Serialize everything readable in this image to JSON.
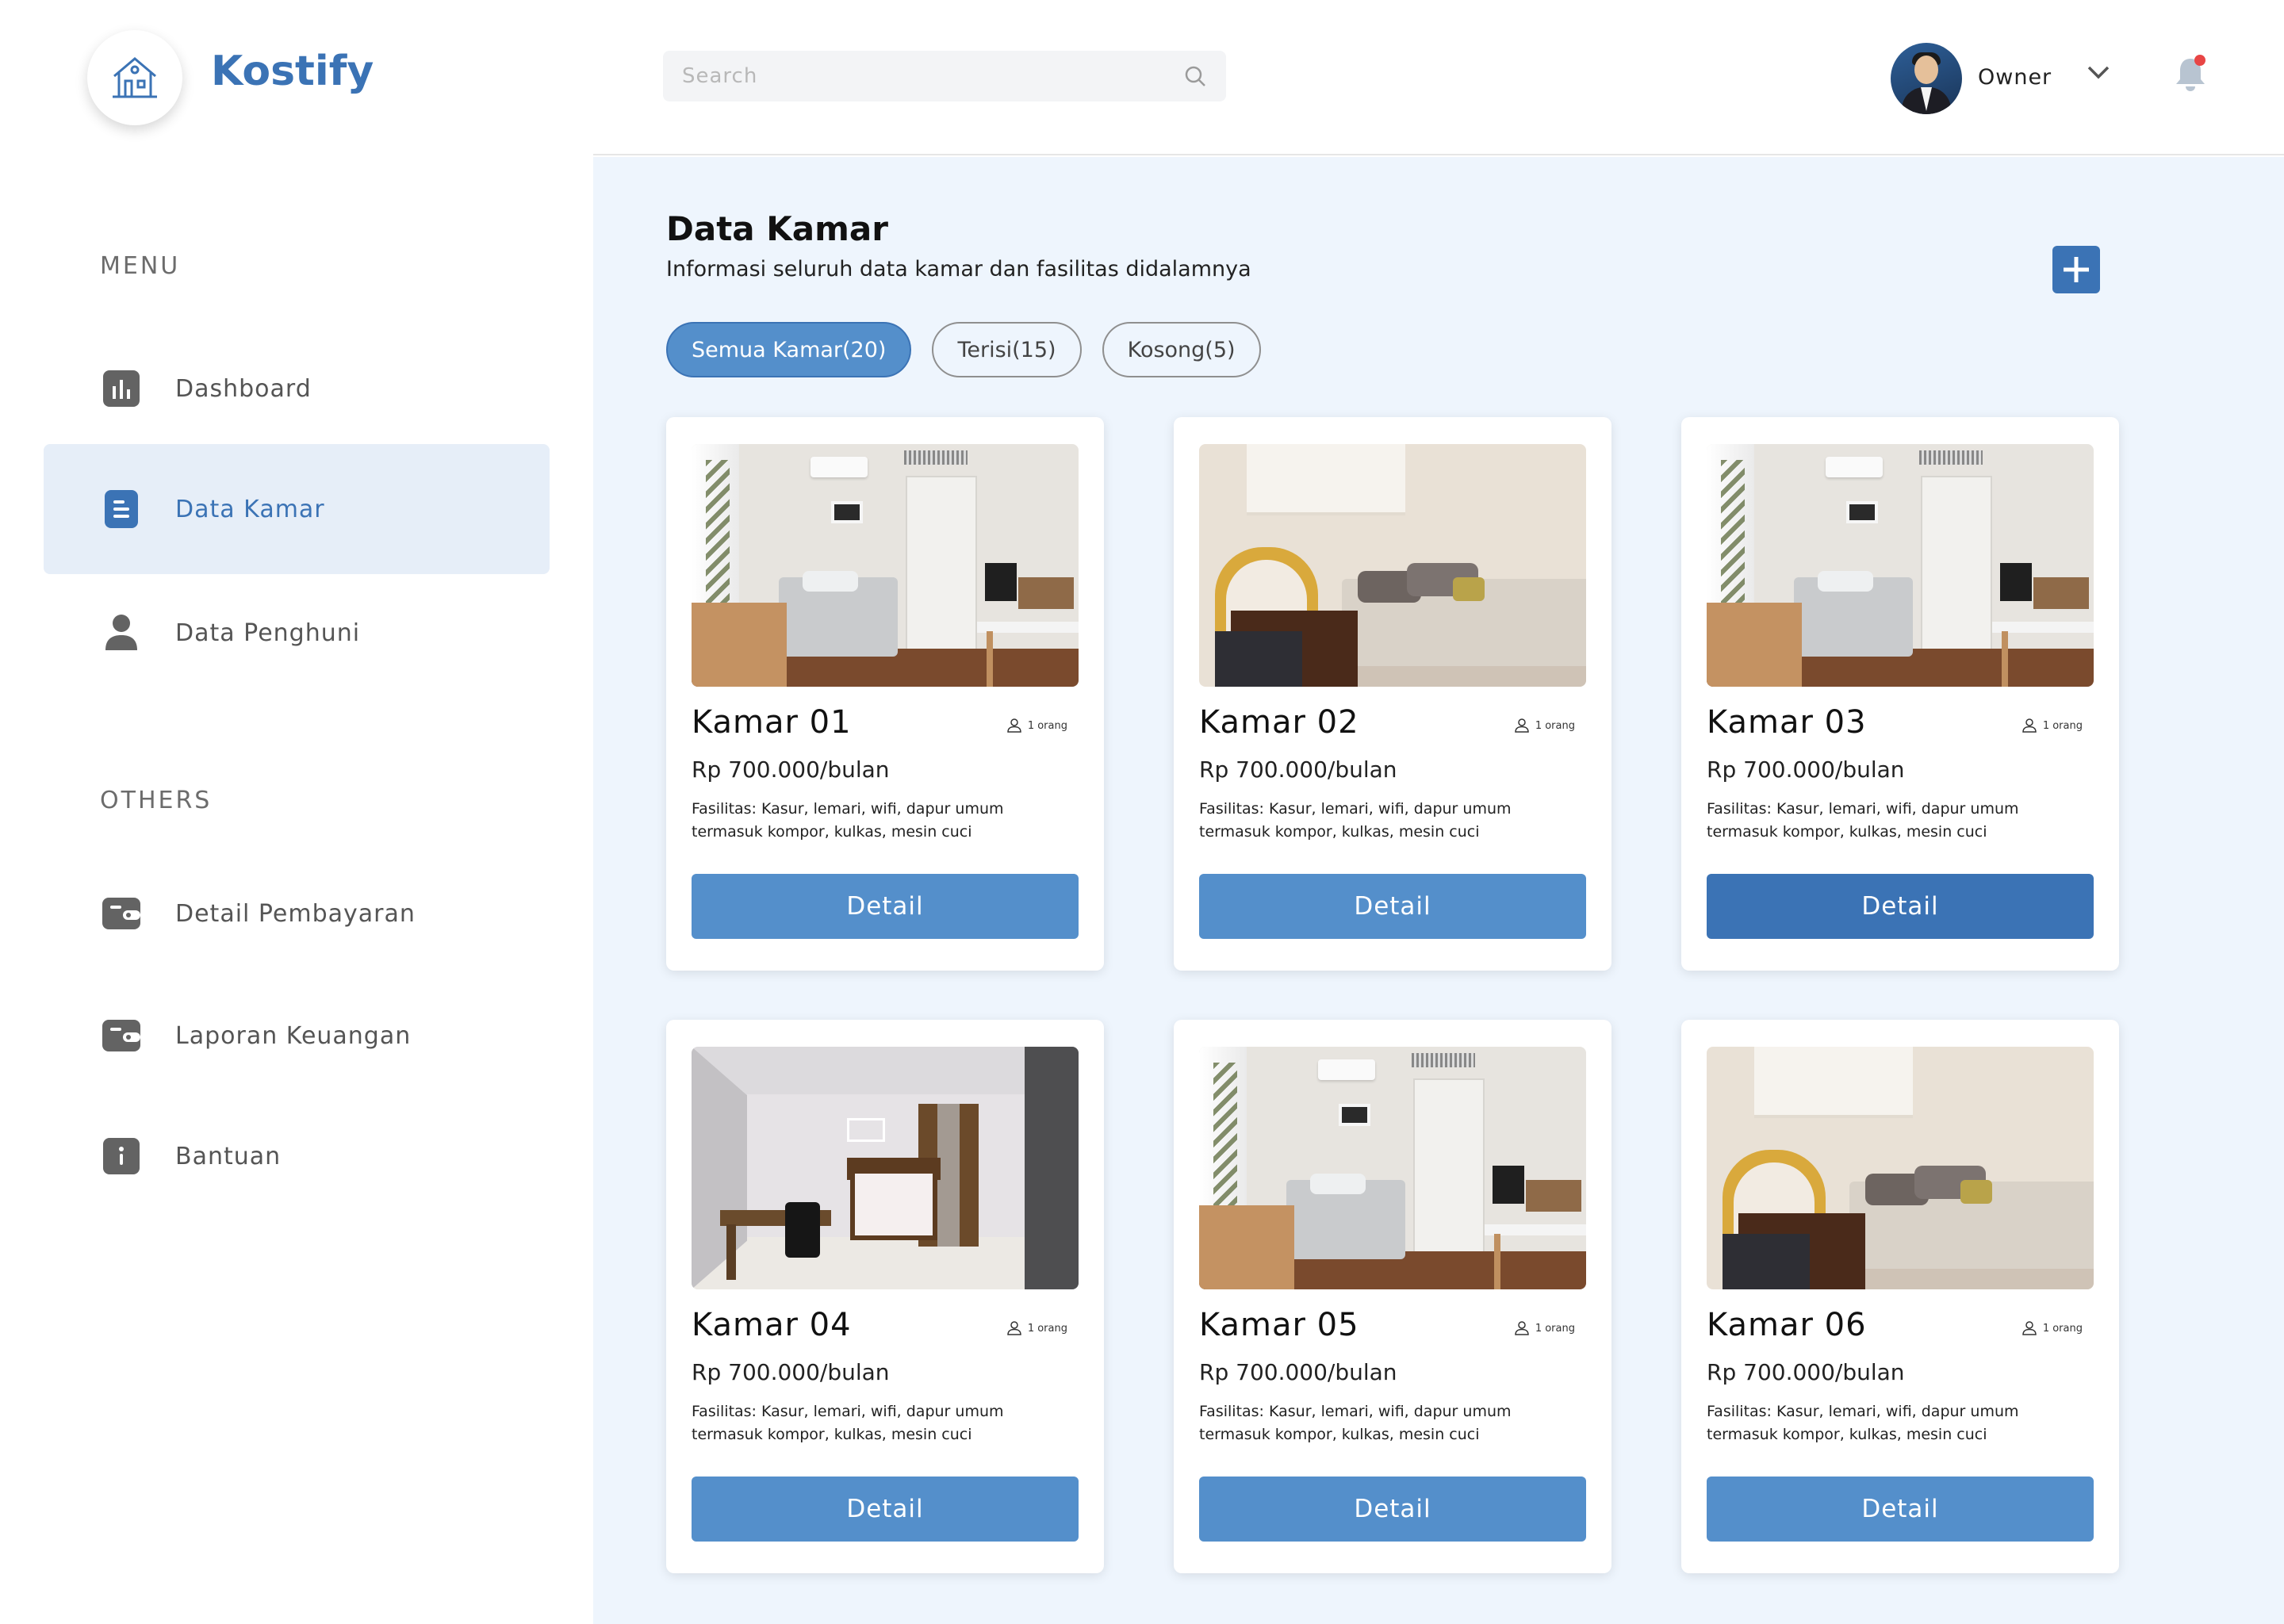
{
  "app": {
    "name": "Kostify"
  },
  "sidebar": {
    "menu_label": "MENU",
    "others_label": "OTHERS",
    "menu_items": [
      {
        "label": "Dashboard",
        "icon": "bar-chart-icon",
        "active": false
      },
      {
        "label": "Data Kamar",
        "icon": "document-icon",
        "active": true
      },
      {
        "label": "Data Penghuni",
        "icon": "user-icon",
        "active": false
      }
    ],
    "other_items": [
      {
        "label": "Detail Pembayaran",
        "icon": "wallet-icon"
      },
      {
        "label": "Laporan Keuangan",
        "icon": "wallet-icon"
      },
      {
        "label": "Bantuan",
        "icon": "info-icon"
      }
    ]
  },
  "header": {
    "search_placeholder": "Search",
    "user_name": "Owner",
    "notification_color": "#e84545"
  },
  "main": {
    "title": "Data Kamar",
    "subtitle": "Informasi seluruh data kamar dan fasilitas didalamnya",
    "filters": [
      {
        "label": "Semua Kamar(20)",
        "active": true
      },
      {
        "label": "Terisi(15)",
        "active": false
      },
      {
        "label": "Kosong(5)",
        "active": false
      }
    ],
    "rooms": [
      {
        "name": "Kamar 01",
        "occupant": "1 orang",
        "price": "Rp 700.000/bulan",
        "facilities": "Fasilitas: Kasur, lemari, wifi, dapur umum termasuk kompor, kulkas, mesin cuci",
        "button": "Detail",
        "photo": "bright-bedroom"
      },
      {
        "name": "Kamar 02",
        "occupant": "1 orang",
        "price": "Rp 700.000/bulan",
        "facilities": "Fasilitas: Kasur, lemari, wifi, dapur umum termasuk kompor, kulkas, mesin cuci",
        "button": "Detail",
        "photo": "warm-bedroom"
      },
      {
        "name": "Kamar 03",
        "occupant": "1 orang",
        "price": "Rp 700.000/bulan",
        "facilities": "Fasilitas: Kasur, lemari, wifi, dapur umum termasuk kompor, kulkas, mesin cuci",
        "button": "Detail",
        "photo": "bright-bedroom"
      },
      {
        "name": "Kamar 04",
        "occupant": "1 orang",
        "price": "Rp 700.000/bulan",
        "facilities": "Fasilitas: Kasur, lemari, wifi, dapur umum termasuk kompor, kulkas, mesin cuci",
        "button": "Detail",
        "photo": "rendered-room"
      },
      {
        "name": "Kamar 05",
        "occupant": "1 orang",
        "price": "Rp 700.000/bulan",
        "facilities": "Fasilitas: Kasur, lemari, wifi, dapur umum termasuk kompor, kulkas, mesin cuci",
        "button": "Detail",
        "photo": "bright-bedroom"
      },
      {
        "name": "Kamar 06",
        "occupant": "1 orang",
        "price": "Rp 700.000/bulan",
        "facilities": "Fasilitas: Kasur, lemari, wifi, dapur umum termasuk kompor, kulkas, mesin cuci",
        "button": "Detail",
        "photo": "warm-bedroom"
      }
    ]
  },
  "colors": {
    "brand": "#3b73b5",
    "button": "#548fcb",
    "button_hover": "#3b73b5",
    "content_bg": "#eef5fd",
    "active_nav_bg": "#e6eef8"
  }
}
